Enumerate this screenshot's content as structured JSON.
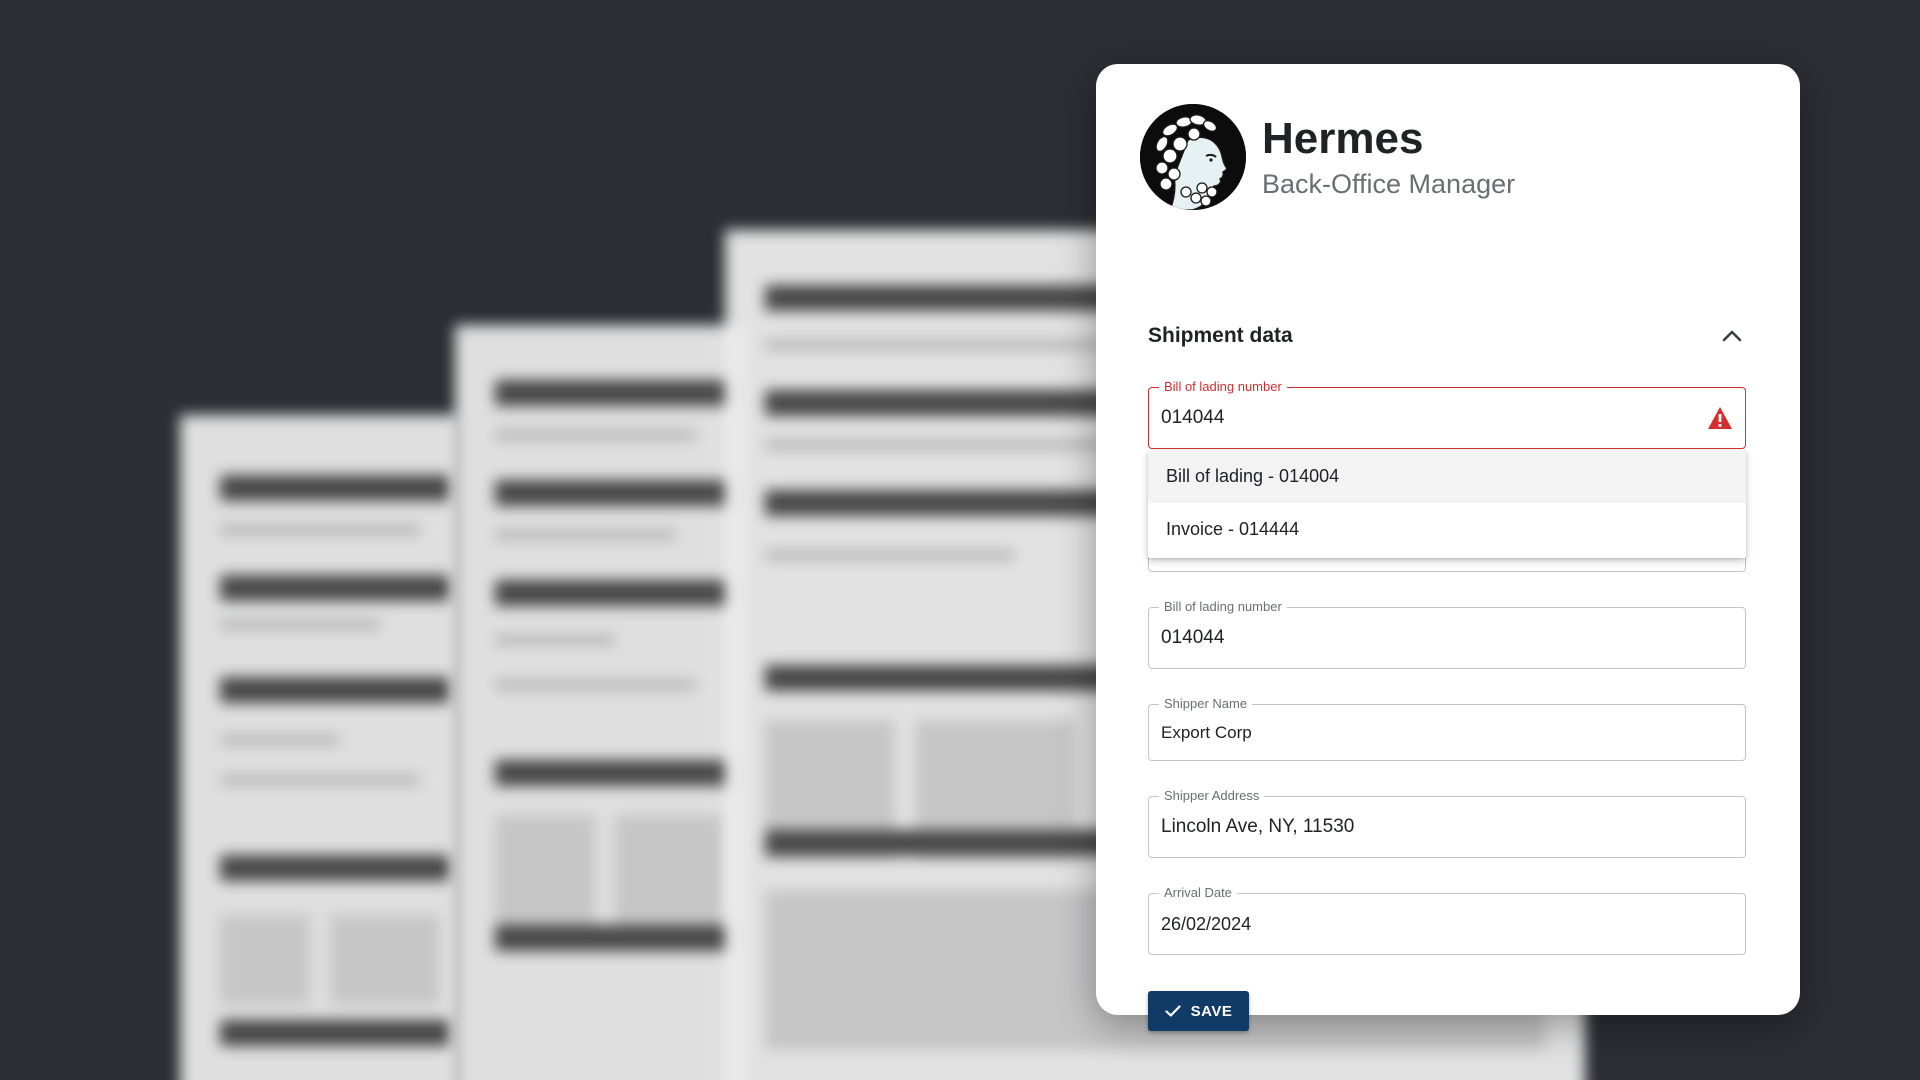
{
  "profile": {
    "name": "Hermes",
    "role": "Back-Office Manager"
  },
  "section": {
    "title": "Shipment data",
    "expanded": true
  },
  "fields": {
    "bill_of_lading_active": {
      "label": "Bill of lading number",
      "value": "014044",
      "state": "error"
    },
    "bill_of_lading": {
      "label": "Bill of lading number",
      "value": "014044"
    },
    "shipper_name": {
      "label": "Shipper Name",
      "value": "Export Corp"
    },
    "shipper_address": {
      "label": "Shipper Address",
      "value": "Lincoln Ave, NY, 11530"
    },
    "arrival_date": {
      "label": "Arrival Date",
      "value": "26/02/2024"
    }
  },
  "suggestions": [
    {
      "label": "Bill of lading - 014004",
      "highlighted": true
    },
    {
      "label": "Invoice - 014444",
      "highlighted": false
    }
  ],
  "actions": {
    "save_label": "SAVE"
  },
  "colors": {
    "background": "#2b2e33",
    "card": "#ffffff",
    "error": "#d32f2f",
    "primary": "#0f3b66",
    "text": "#202226",
    "muted": "#6b6e73"
  },
  "icons": {
    "warning": "warning-icon",
    "chevron": "chevron-up-icon",
    "check": "check-icon"
  }
}
